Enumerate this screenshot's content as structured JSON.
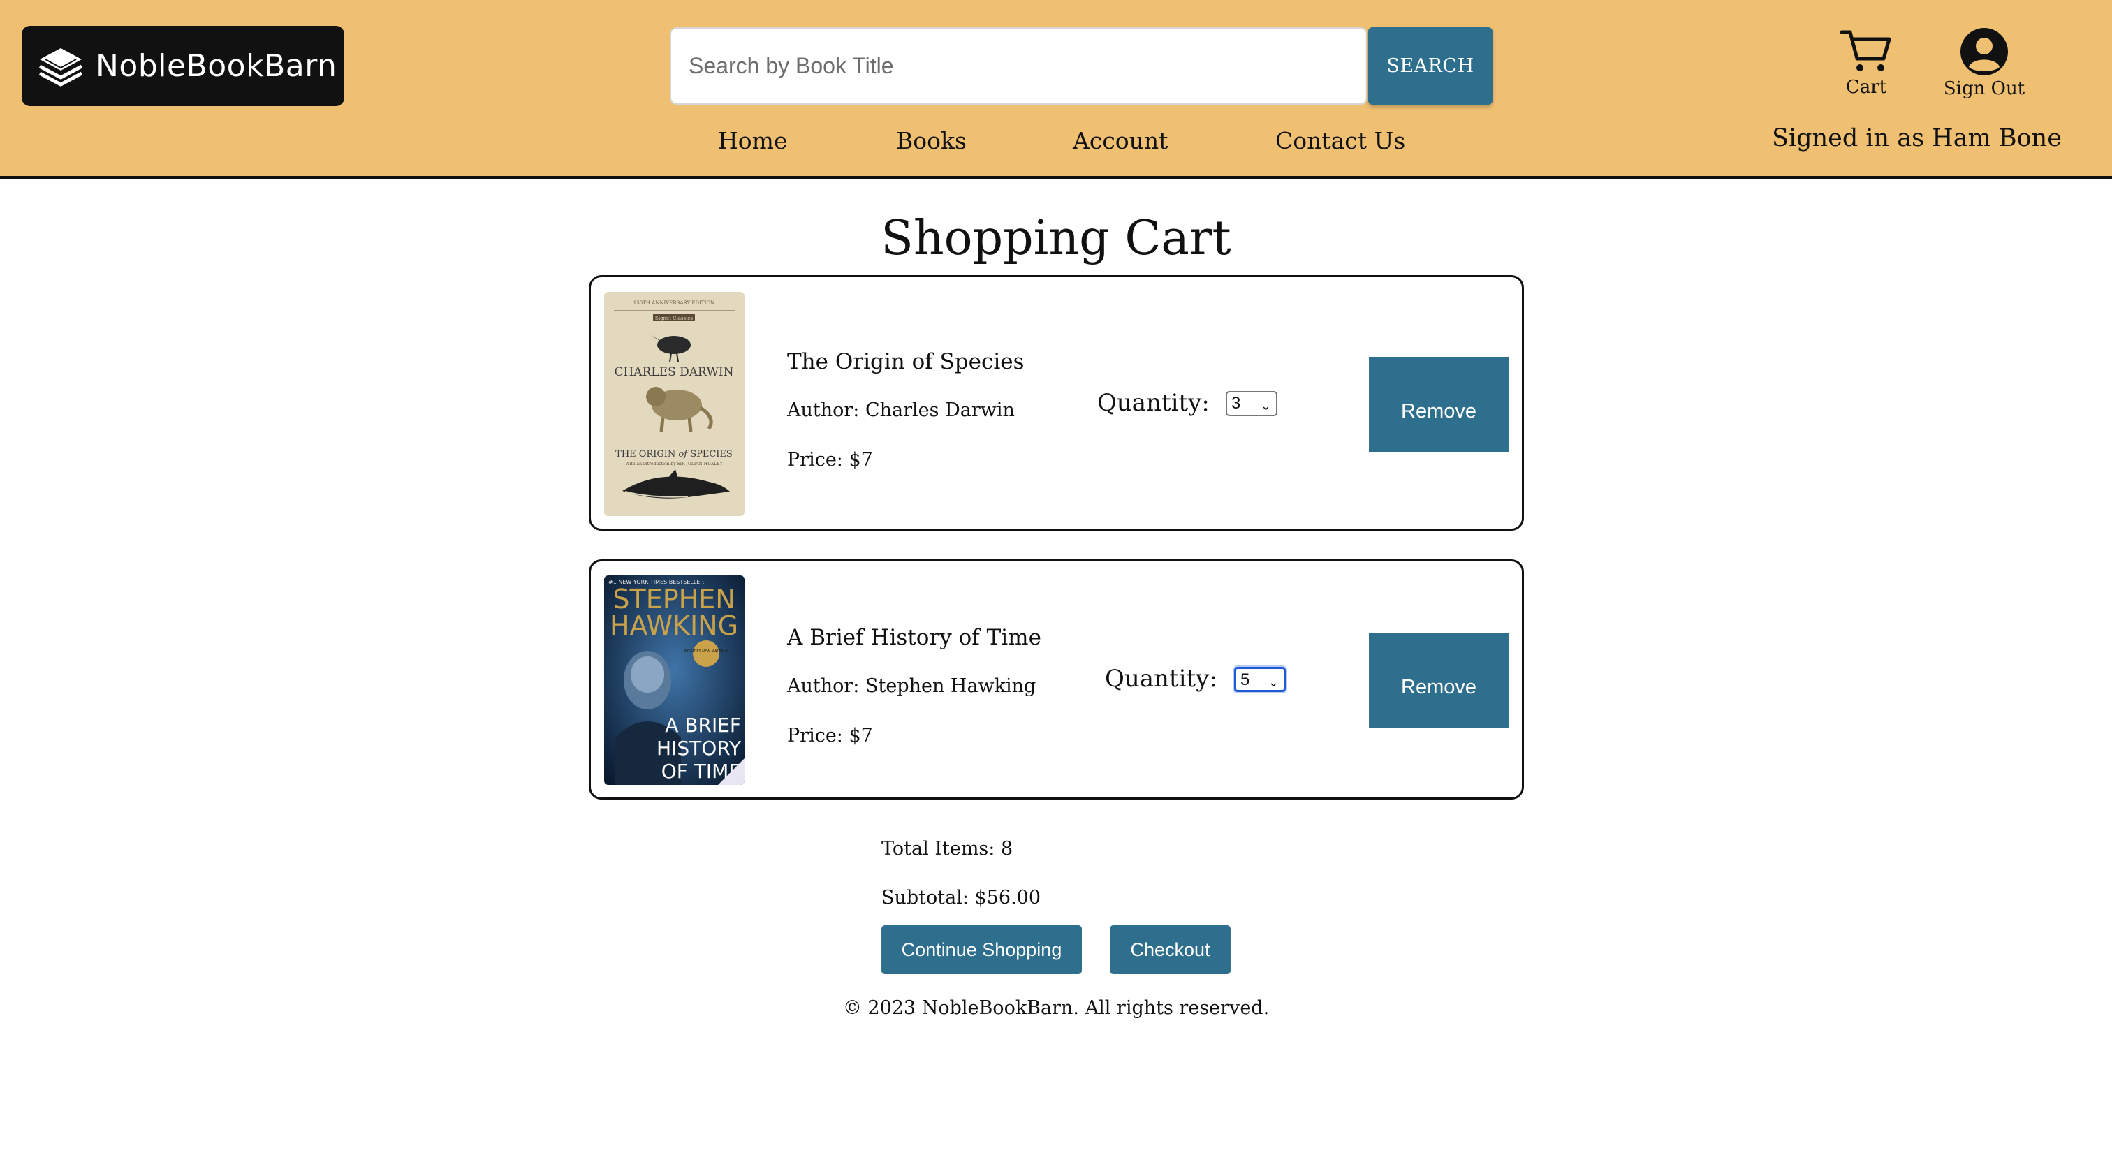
{
  "brand": {
    "name": "NobleBookBarn"
  },
  "search": {
    "placeholder": "Search by Book Title",
    "button_label": "SEARCH"
  },
  "nav": [
    {
      "label": "Home"
    },
    {
      "label": "Books"
    },
    {
      "label": "Account"
    },
    {
      "label": "Contact Us"
    }
  ],
  "header_actions": {
    "cart_label": "Cart",
    "signout_label": "Sign Out",
    "signed_in_text": "Signed in as Ham Bone"
  },
  "page": {
    "title": "Shopping Cart"
  },
  "cart": {
    "items": [
      {
        "title": "The Origin of Species",
        "author": "Author: Charles Darwin",
        "price": "Price: $7",
        "quantity_label": "Quantity:",
        "quantity": "3",
        "remove_label": "Remove",
        "cover": {
          "edition": "150TH ANNIVERSARY EDITION",
          "publisher": "Signet Classics",
          "author": "CHARLES DARWIN",
          "title_pre": "THE ORIGIN",
          "title_of": "of",
          "title_post": "SPECIES",
          "intro": "With an introduction by SIR JULIAN HUXLEY"
        }
      },
      {
        "title": "A Brief History of Time",
        "author": "Author: Stephen Hawking",
        "price": "Price: $7",
        "quantity_label": "Quantity:",
        "quantity": "5",
        "remove_label": "Remove",
        "cover": {
          "bestseller": "#1 NEW YORK TIMES BESTSELLER",
          "author_first": "STEPHEN",
          "author_last": "HAWKING",
          "badge": "INCLUDES NEW MATERIAL",
          "title_1": "A BRIEF",
          "title_2": "HISTORY",
          "title_3": "OF TIME"
        }
      }
    ]
  },
  "summary": {
    "total_items": "Total Items: 8",
    "subtotal": "Subtotal: $56.00",
    "continue_label": "Continue Shopping",
    "checkout_label": "Checkout"
  },
  "footer": {
    "text": "© 2023 NobleBookBarn. All rights reserved."
  },
  "colors": {
    "header_bg": "#f0c072",
    "accent": "#2f6f8e",
    "logo_bg": "#111111"
  }
}
